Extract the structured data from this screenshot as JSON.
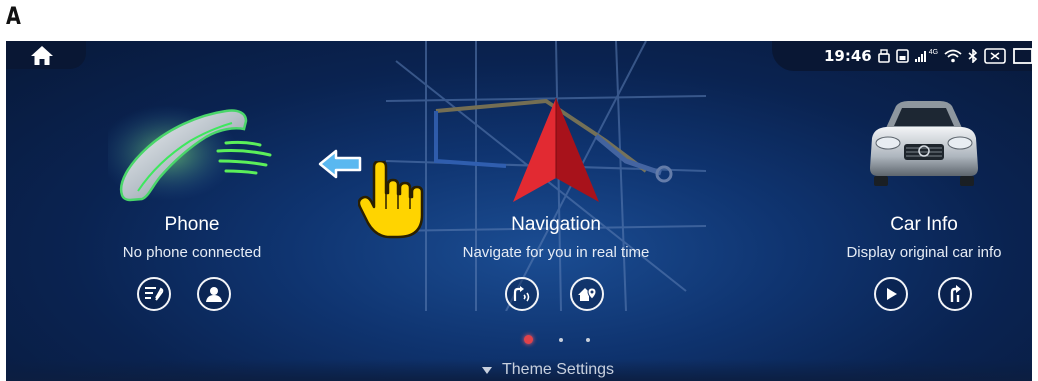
{
  "figure_label": "A",
  "status": {
    "time": "19:46",
    "network": "4G"
  },
  "apps": [
    {
      "name": "phone",
      "title": "Phone",
      "subtitle": "No phone connected",
      "buttons": [
        "call-log-icon",
        "contacts-icon"
      ]
    },
    {
      "name": "navigation",
      "title": "Navigation",
      "subtitle": "Navigate for you in real time",
      "buttons": [
        "voice-nav-icon",
        "home-nav-icon"
      ]
    },
    {
      "name": "car-info",
      "title": "Car Info",
      "subtitle": "Display original car info",
      "buttons": [
        "play-icon",
        "turn-icon"
      ]
    }
  ],
  "pagination": {
    "pages": 3,
    "active": 1
  },
  "theme_settings": {
    "label": "Theme Settings"
  },
  "colors": {
    "screen_bg": "#0f3470",
    "nav_arrow": "#d8222b",
    "active_dot": "#e0424a",
    "swipe_arrow": "#5ab8f0",
    "hand": "#ffd400"
  }
}
